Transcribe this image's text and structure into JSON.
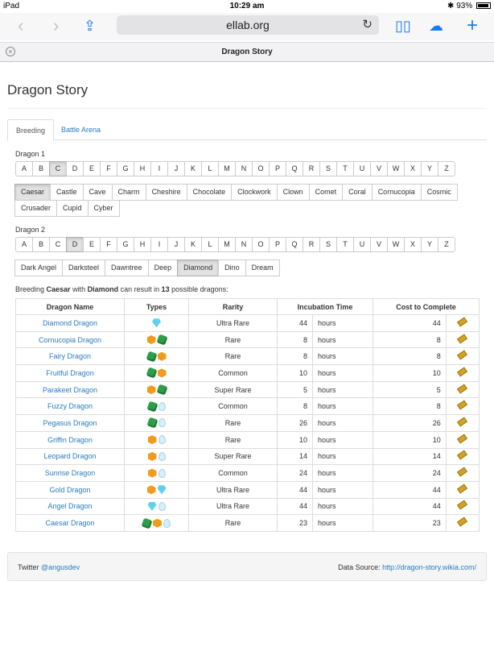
{
  "status": {
    "device": "iPad",
    "time": "10:29 am",
    "battery": "93%"
  },
  "browser": {
    "url": "ellab.org",
    "tab_title": "Dragon Story"
  },
  "page": {
    "title": "Dragon Story",
    "tabs": [
      "Breeding",
      "Battle Arena"
    ],
    "dragon1_label": "Dragon 1",
    "dragon2_label": "Dragon 2",
    "letters": [
      "A",
      "B",
      "C",
      "D",
      "E",
      "F",
      "G",
      "H",
      "I",
      "J",
      "K",
      "L",
      "M",
      "N",
      "O",
      "P",
      "Q",
      "R",
      "S",
      "T",
      "U",
      "V",
      "W",
      "X",
      "Y",
      "Z"
    ],
    "dragon1_selected_letter": "C",
    "dragon2_selected_letter": "D",
    "dragon1_names": [
      "Caesar",
      "Castle",
      "Cave",
      "Charm",
      "Cheshire",
      "Chocolate",
      "Clockwork",
      "Clown",
      "Comet",
      "Coral",
      "Cornucopia",
      "Cosmic",
      "Crusader",
      "Cupid",
      "Cyber"
    ],
    "dragon1_selected": "Caesar",
    "dragon2_names": [
      "Dark Angel",
      "Darksteel",
      "Dawntree",
      "Deep",
      "Diamond",
      "Dino",
      "Dream"
    ],
    "dragon2_selected": "Diamond",
    "summary": {
      "prefix": "Breeding ",
      "d1": "Caesar",
      "mid": " with ",
      "d2": "Diamond",
      "mid2": " can result in ",
      "count": "13",
      "suffix": " possible dragons:"
    },
    "columns": [
      "Dragon Name",
      "Types",
      "Rarity",
      "Incubation Time",
      "Cost to Complete"
    ],
    "rows": [
      {
        "name": "Diamond Dragon",
        "types": [
          "blue"
        ],
        "rarity": "Ultra Rare",
        "incubation": "44",
        "unit": "hours",
        "cost": "44"
      },
      {
        "name": "Cornucopia Dragon",
        "types": [
          "orange",
          "green"
        ],
        "rarity": "Rare",
        "incubation": "8",
        "unit": "hours",
        "cost": "8"
      },
      {
        "name": "Fairy Dragon",
        "types": [
          "green",
          "orange"
        ],
        "rarity": "Rare",
        "incubation": "8",
        "unit": "hours",
        "cost": "8"
      },
      {
        "name": "Fruitful Dragon",
        "types": [
          "green",
          "orange"
        ],
        "rarity": "Common",
        "incubation": "10",
        "unit": "hours",
        "cost": "10"
      },
      {
        "name": "Parakeet Dragon",
        "types": [
          "orange",
          "green"
        ],
        "rarity": "Super Rare",
        "incubation": "5",
        "unit": "hours",
        "cost": "5"
      },
      {
        "name": "Fuzzy Dragon",
        "types": [
          "green",
          "drop"
        ],
        "rarity": "Common",
        "incubation": "8",
        "unit": "hours",
        "cost": "8"
      },
      {
        "name": "Pegasus Dragon",
        "types": [
          "green",
          "drop"
        ],
        "rarity": "Rare",
        "incubation": "26",
        "unit": "hours",
        "cost": "26"
      },
      {
        "name": "Griffin Dragon",
        "types": [
          "orange",
          "drop"
        ],
        "rarity": "Rare",
        "incubation": "10",
        "unit": "hours",
        "cost": "10"
      },
      {
        "name": "Leopard Dragon",
        "types": [
          "orange",
          "drop"
        ],
        "rarity": "Super Rare",
        "incubation": "14",
        "unit": "hours",
        "cost": "14"
      },
      {
        "name": "Sunrise Dragon",
        "types": [
          "orange",
          "drop"
        ],
        "rarity": "Common",
        "incubation": "24",
        "unit": "hours",
        "cost": "24"
      },
      {
        "name": "Gold Dragon",
        "types": [
          "orange",
          "blue"
        ],
        "rarity": "Ultra Rare",
        "incubation": "44",
        "unit": "hours",
        "cost": "44"
      },
      {
        "name": "Angel Dragon",
        "types": [
          "blue",
          "drop"
        ],
        "rarity": "Ultra Rare",
        "incubation": "44",
        "unit": "hours",
        "cost": "44"
      },
      {
        "name": "Caesar Dragon",
        "types": [
          "green",
          "orange",
          "drop"
        ],
        "rarity": "Rare",
        "incubation": "23",
        "unit": "hours",
        "cost": "23"
      }
    ],
    "footer": {
      "twitter_label": "Twitter ",
      "twitter_handle": "@angusdev",
      "source_label": "Data Source: ",
      "source_link": "http://dragon-story.wikia.com/"
    }
  },
  "colors": {
    "link": "#2a7bc0",
    "ios_blue": "#1a7bf5",
    "selected_bg": "#e2e2e2"
  }
}
